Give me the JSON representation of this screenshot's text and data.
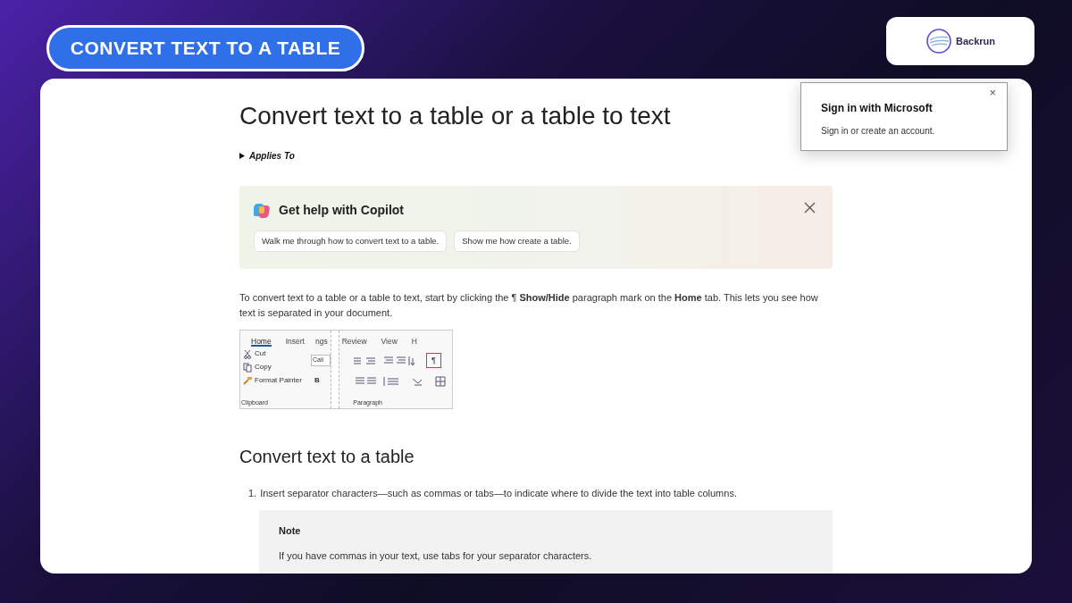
{
  "banner": {
    "title": "CONVERT TEXT TO A TABLE"
  },
  "logo": {
    "text": "Backrun"
  },
  "article": {
    "title": "Convert text to a table or a table to text",
    "applies_to": "Applies To",
    "copilot": {
      "title": "Get help with Copilot",
      "suggestions": [
        "Walk me through how to convert text to a table.",
        "Show me how create a table."
      ]
    },
    "intro": "To convert text to a table or a table to text, start by clicking the ¶  **Show/Hide** paragraph mark on the **Home** tab. This lets you see how text is separated in your document.",
    "ribbon": {
      "tabs": [
        {
          "label": "Home",
          "selected": true
        },
        {
          "label": "Insert",
          "selected": false
        },
        {
          "label": "ngs",
          "selected": false
        },
        {
          "label": "Review",
          "selected": false
        },
        {
          "label": "View",
          "selected": false
        },
        {
          "label": "H",
          "selected": false
        }
      ],
      "clipboard": [
        "Cut",
        "Copy",
        "Format Painter"
      ],
      "clipboard_label": "Clipboard",
      "font_box": "Cali",
      "bold": "B",
      "pilcrow": {
        "label": "¶",
        "selected": true
      },
      "paragraph_label": "Paragraph"
    },
    "section_title": "Convert text to a table",
    "steps": [
      {
        "number": "1.",
        "text": "Insert separator characters—such as commas or tabs—to indicate where to divide the text into table columns."
      }
    ],
    "note": {
      "title": "Note",
      "text": "If you have commas in your text, use tabs for your separator characters."
    }
  },
  "popup": {
    "title": "Sign in with Microsoft",
    "text": "Sign in or create an account.",
    "close": "×"
  }
}
